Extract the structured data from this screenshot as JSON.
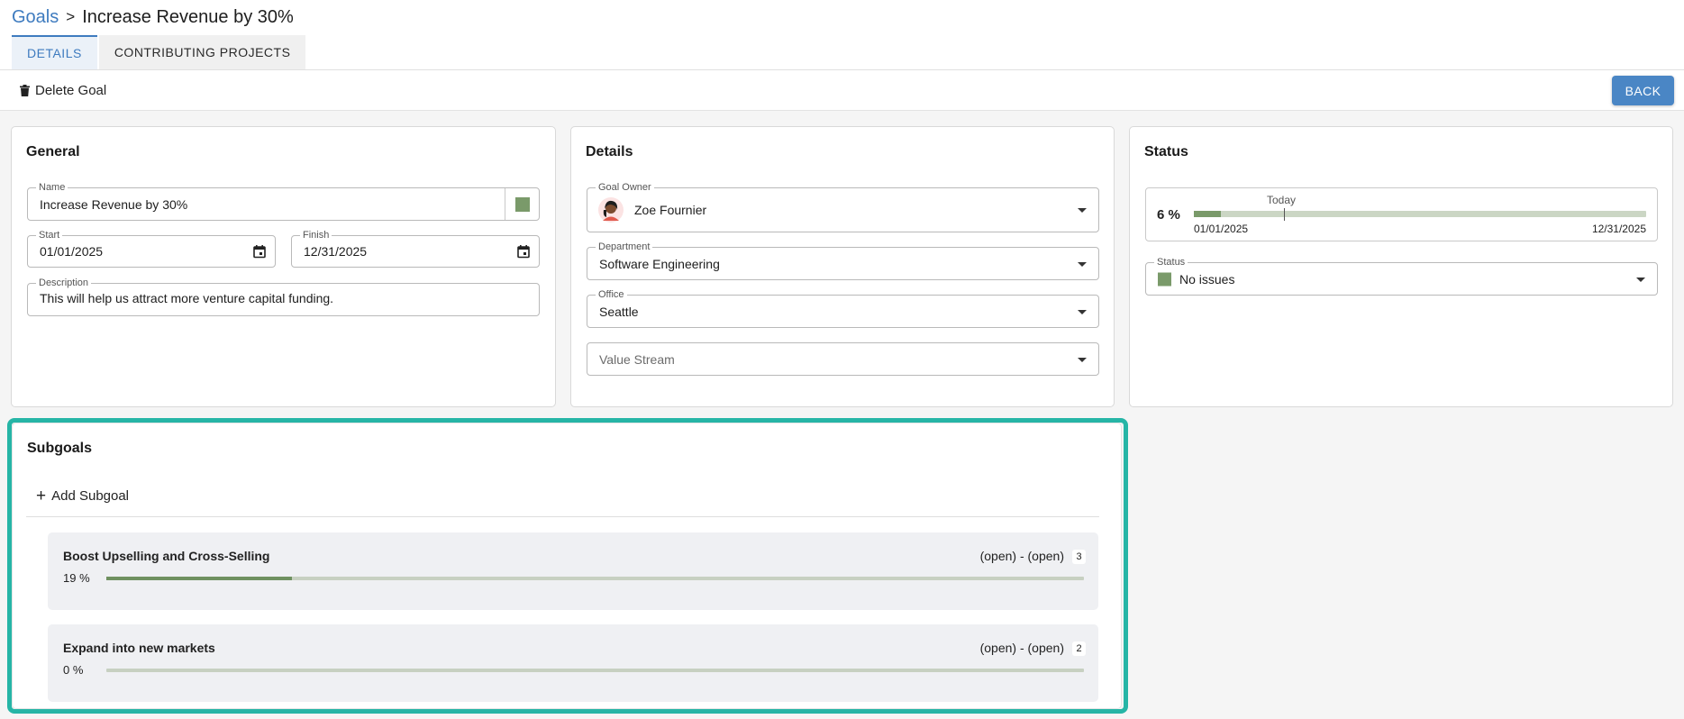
{
  "breadcrumb": {
    "root": "Goals",
    "separator": ">",
    "current": "Increase Revenue by 30%"
  },
  "tabs": [
    {
      "label": "DETAILS",
      "active": true
    },
    {
      "label": "CONTRIBUTING PROJECTS",
      "active": false
    }
  ],
  "toolbar": {
    "delete_label": "Delete Goal",
    "back_label": "BACK"
  },
  "general": {
    "title": "General",
    "name": {
      "label": "Name",
      "value": "Increase Revenue by 30%",
      "color": "#7a9a6a"
    },
    "start": {
      "label": "Start",
      "value": "01/01/2025"
    },
    "finish": {
      "label": "Finish",
      "value": "12/31/2025"
    },
    "description": {
      "label": "Description",
      "value": "This will help us attract more venture capital funding."
    }
  },
  "details": {
    "title": "Details",
    "owner": {
      "label": "Goal Owner",
      "value": "Zoe Fournier"
    },
    "department": {
      "label": "Department",
      "value": "Software Engineering"
    },
    "office": {
      "label": "Office",
      "value": "Seattle"
    },
    "value_stream": {
      "placeholder": "Value Stream"
    }
  },
  "status": {
    "title": "Status",
    "progress_label": "6 %",
    "progress": 0.06,
    "today_label": "Today",
    "today_fraction": 0.2,
    "start_date": "01/01/2025",
    "end_date": "12/31/2025",
    "status_field": {
      "label": "Status",
      "value": "No issues",
      "color": "#7a9a6a"
    }
  },
  "subgoals": {
    "title": "Subgoals",
    "add_label": "Add Subgoal",
    "items": [
      {
        "name": "Boost Upselling and Cross-Selling",
        "dates": "(open) - (open)",
        "count": "3",
        "percent_label": "19 %",
        "progress": 0.19
      },
      {
        "name": "Expand into new markets",
        "dates": "(open) - (open)",
        "count": "2",
        "percent_label": "0 %",
        "progress": 0.0
      }
    ]
  },
  "colors": {
    "accent": "#3e7bbf",
    "highlight": "#26b5a6",
    "progress": "#7a9a6a"
  }
}
